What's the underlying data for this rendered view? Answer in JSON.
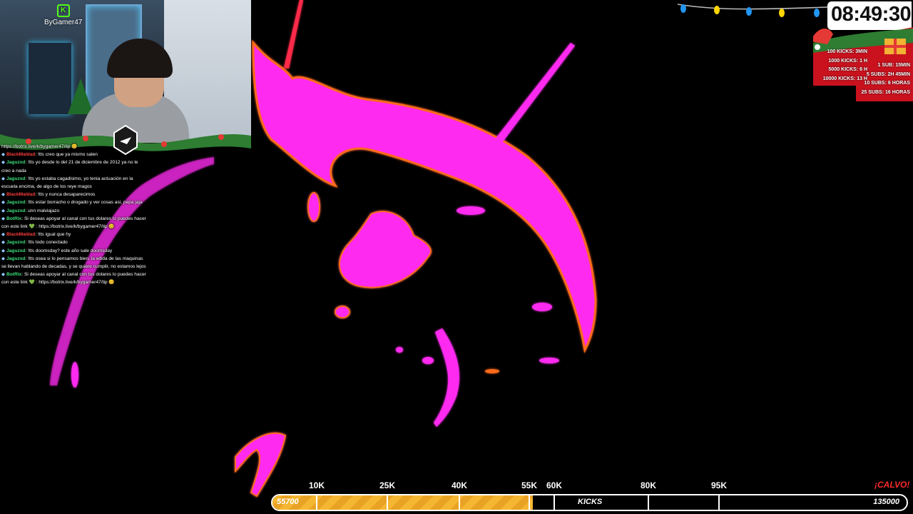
{
  "stream": {
    "webcam": {
      "logo_text": "ByGamer47"
    },
    "clock": {
      "time": "08:49:30"
    },
    "kick_goals": [
      {
        "text": "100 KICKS: 3MIN"
      },
      {
        "text": "1000 KICKS: 1 H"
      },
      {
        "text": "5000 KICKS: 6 H"
      },
      {
        "text": "10000 KICKS: 13 H"
      }
    ],
    "sub_goals": [
      {
        "text": "1 SUB: 15MIN"
      },
      {
        "text": "5 SUBS: 2H 45MIN"
      },
      {
        "text": "10 SUBS: 6 HORAS"
      },
      {
        "text": "25 SUBS: 16 HORAS"
      }
    ],
    "colors": {
      "gameplay_magenta": "#ff2bf0",
      "gameplay_orange": "#ff6a1a",
      "kick_green": "#53fc18",
      "progress_fill": "#f5b731",
      "calvo_red": "#ff2a2a"
    }
  },
  "chat": {
    "messages": [
      {
        "user": "",
        "text": "https://botrix.live/k/bygamer47/tip 😊",
        "user_color": "#ffffff"
      },
      {
        "user": "BlackMaldad",
        "text": ": !tts creo que ya mismo salen",
        "user_color": "#ff3b3b"
      },
      {
        "user": "Jaguzxd",
        "text": ": !tts yo desde lo del 21 de diciembre de 2012 ya no le creo a nada",
        "user_color": "#3ee07a"
      },
      {
        "user": "Jaguzxd",
        "text": ": !tts yo estaba cagadisimo, yo tenia actuación en la escuela encima, de algo de los reye magos",
        "user_color": "#3ee07a"
      },
      {
        "user": "BlackMaldad",
        "text": ": !tts y nunca desaparecimos",
        "user_color": "#ff3b3b"
      },
      {
        "user": "Jaguzxd",
        "text": ": !tts estar borracho o drogado y ver cosas asi, pepa jaja",
        "user_color": "#3ee07a"
      },
      {
        "user": "Jaguzxd",
        "text": ": unn malviajazo",
        "user_color": "#3ee07a"
      },
      {
        "user": "BotRix",
        "text": ": Si deseas apoyar al canal con tus dolares lo puedes hacer con este link 💚 : https://botrix.live/k/bygamer47/tip 😊",
        "user_color": "#3ee07a"
      },
      {
        "user": "BlackMaldad",
        "text": ": !tts igual que hy",
        "user_color": "#ff3b3b"
      },
      {
        "user": "Jaguzxd",
        "text": ": !tts todo conectado",
        "user_color": "#3ee07a"
      },
      {
        "user": "Jaguzxd",
        "text": ": !tts doomsday? este año sale doomsday",
        "user_color": "#3ee07a"
      },
      {
        "user": "Jaguzxd",
        "text": ": !tts osea si lo pensamos bien, la wbda de las maquinas se llevan hablando de decadas, y se quiere cumplir, no estamos lejos",
        "user_color": "#3ee07a"
      },
      {
        "user": "BotRix",
        "text": ": Si deseas apoyar al canal con tus dolares lo puedes hacer con este link 💚 : https://botrix.live/k/bygamer47/tip 😊",
        "user_color": "#3ee07a"
      }
    ]
  },
  "progress_bar": {
    "start_label": "55700",
    "end_label": "135000",
    "center_label": "KICKS",
    "current_value": 55700,
    "min_value": 0,
    "max_value": 135000,
    "milestones": [
      {
        "label": "10K",
        "value": 10000
      },
      {
        "label": "25K",
        "value": 25000
      },
      {
        "label": "40K",
        "value": 40000
      },
      {
        "label": "55K",
        "value": 55000
      },
      {
        "label": "60K",
        "value": 60000
      },
      {
        "label": "80K",
        "value": 80000
      },
      {
        "label": "95K",
        "value": 95000
      }
    ],
    "final_reward": "¡CALVO!"
  }
}
